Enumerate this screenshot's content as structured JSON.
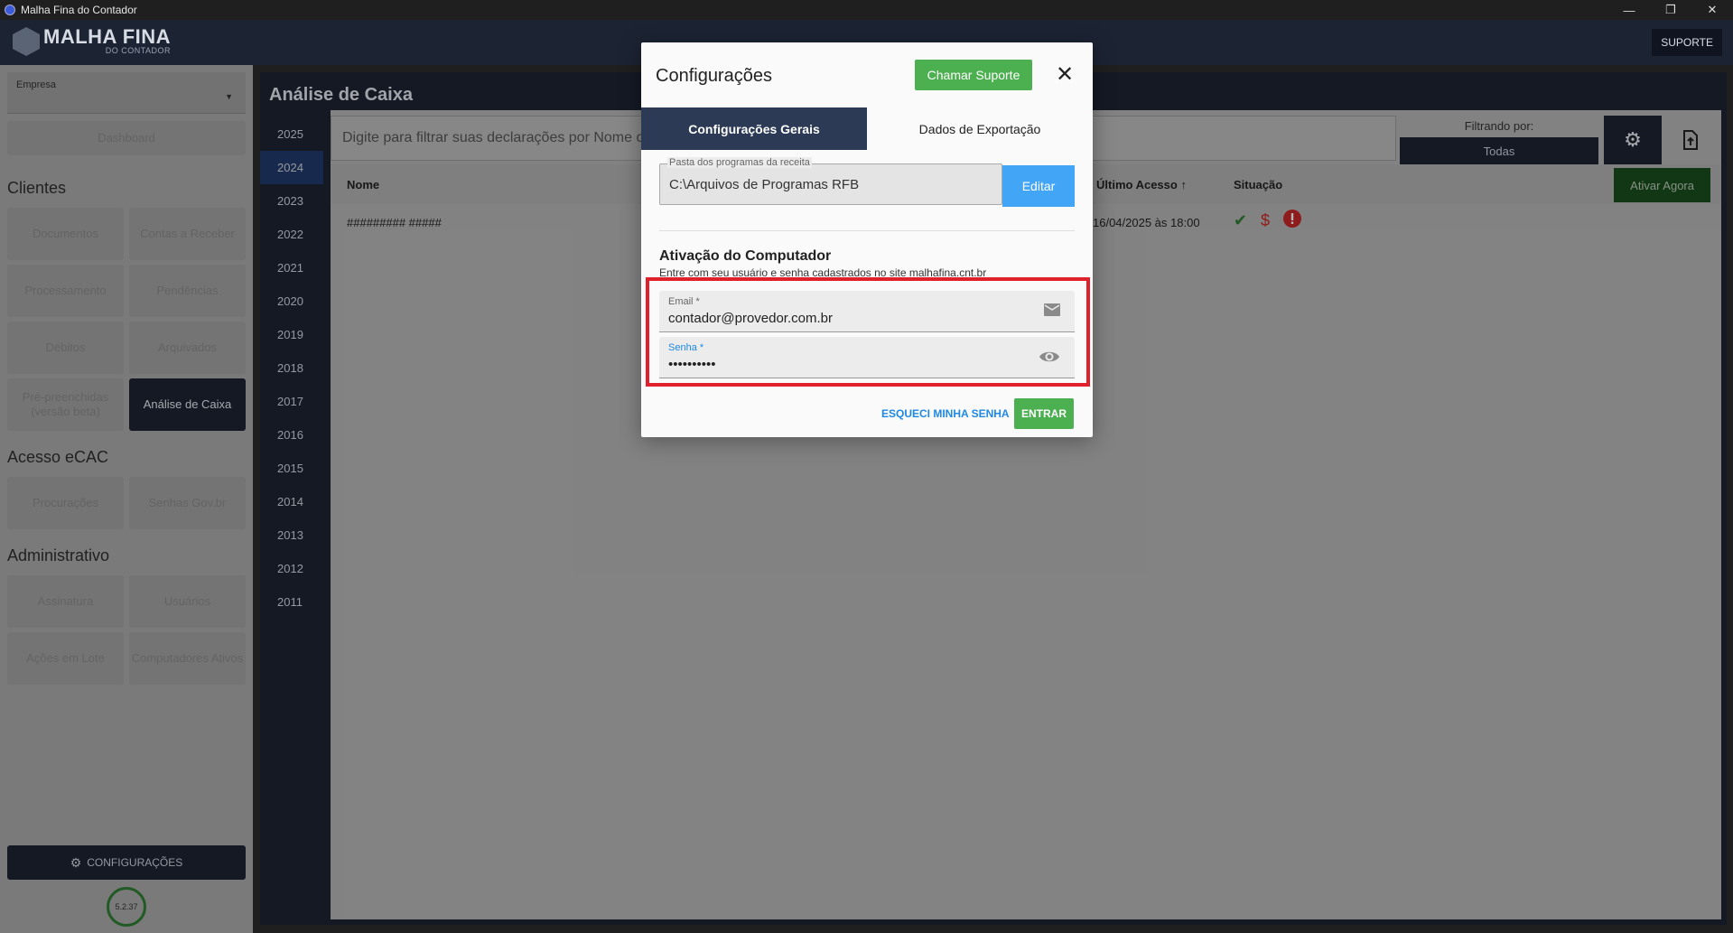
{
  "window": {
    "title": "Malha Fina do Contador",
    "controls": [
      "—",
      "❐",
      "✕"
    ]
  },
  "header": {
    "logo_text": "MALHA FINA",
    "logo_sub": "DO CONTADOR",
    "support_label": "SUPORTE"
  },
  "sidebar": {
    "empresa_label": "Empresa",
    "dashboard": "Dashboard",
    "clientes_heading": "Clientes",
    "clientes": [
      "Documentos",
      "Contas a Receber",
      "Processamento",
      "Pendências",
      "Débitos",
      "Arquivados",
      "Pré-preenchidas (versão beta)",
      "Análise de Caixa"
    ],
    "ecac_heading": "Acesso eCAC",
    "ecac": [
      "Procurações",
      "Senhas Gov.br"
    ],
    "admin_heading": "Administrativo",
    "admin": [
      "Assinatura",
      "Usuários",
      "Ações em Lote",
      "Computadores Ativos"
    ],
    "config_label": "CONFIGURAÇÕES",
    "version": "5.2.37"
  },
  "main": {
    "title": "Análise de Caixa",
    "years": [
      "2025",
      "2024",
      "2023",
      "2022",
      "2021",
      "2020",
      "2019",
      "2018",
      "2017",
      "2016",
      "2015",
      "2014",
      "2013",
      "2012",
      "2011"
    ],
    "active_year": "2024",
    "filter_placeholder": "Digite para filtrar suas declarações por Nome o",
    "filtrando_label": "Filtrando por:",
    "filtrando_value": "Todas",
    "columns": {
      "nome": "Nome",
      "ultimo_acesso": "Último Acesso",
      "situacao": "Situação"
    },
    "ativar_label": "Ativar Agora",
    "rows": [
      {
        "nome": "######### #####",
        "ultimo_acesso": "16/04/2025 às 18:00"
      }
    ]
  },
  "modal": {
    "title": "Configurações",
    "support_button": "Chamar Suporte",
    "tabs": [
      "Configurações Gerais",
      "Dados de Exportação"
    ],
    "pasta_label": "Pasta dos programas da receita",
    "pasta_value": "C:\\Arquivos de Programas RFB",
    "editar_label": "Editar",
    "ativacao_title": "Ativação do Computador",
    "ativacao_subtitle": "Entre com seu usuário e senha cadastrados no site malhafina.cnt.br",
    "email_label": "Email *",
    "email_value": "contador@provedor.com.br",
    "senha_label": "Senha *",
    "senha_value": "••••••••••",
    "forgot_label": "ESQUECI MINHA SENHA",
    "login_label": "ENTRAR"
  },
  "colors": {
    "navy": "#1c2333",
    "green": "#4caf50",
    "blue": "#42a5f5",
    "highlight": "#e0202a"
  }
}
